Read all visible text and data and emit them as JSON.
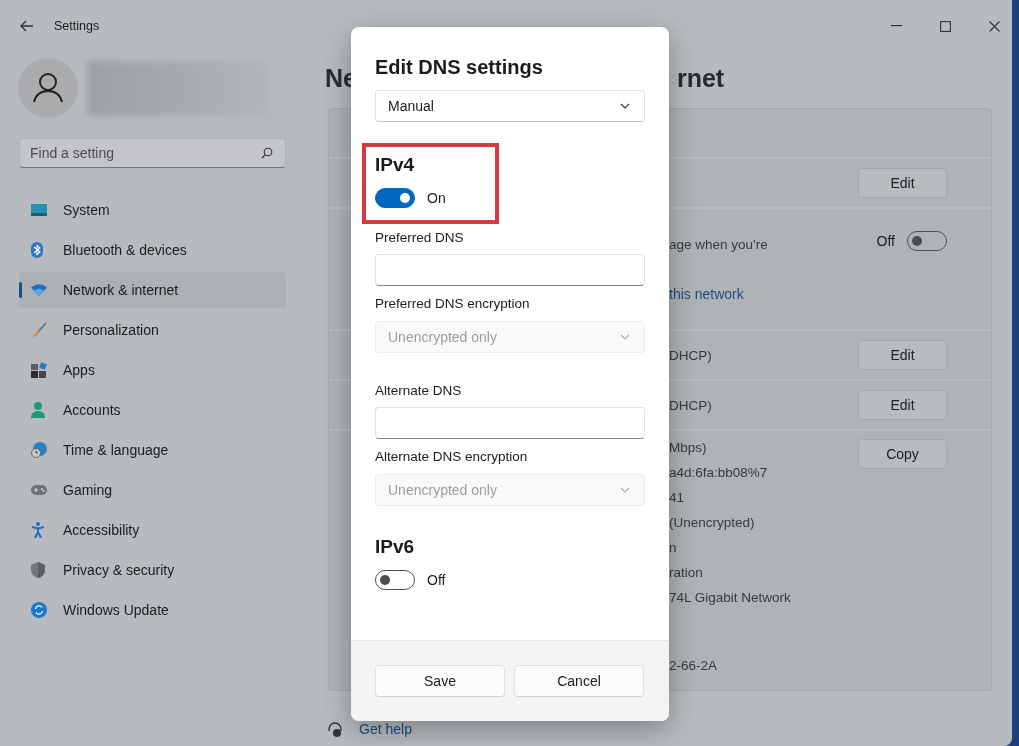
{
  "window": {
    "title": "Settings"
  },
  "sidebar": {
    "search": {
      "placeholder": "Find a setting"
    },
    "items": [
      {
        "label": "System",
        "selected": false
      },
      {
        "label": "Bluetooth & devices",
        "selected": false
      },
      {
        "label": "Network & internet",
        "selected": true
      },
      {
        "label": "Personalization",
        "selected": false
      },
      {
        "label": "Apps",
        "selected": false
      },
      {
        "label": "Accounts",
        "selected": false
      },
      {
        "label": "Time & language",
        "selected": false
      },
      {
        "label": "Gaming",
        "selected": false
      },
      {
        "label": "Accessibility",
        "selected": false
      },
      {
        "label": "Privacy & security",
        "selected": false
      },
      {
        "label": "Windows Update",
        "selected": false
      }
    ]
  },
  "page": {
    "title_parts": [
      "Ne",
      "rnet"
    ],
    "rows": [
      {
        "button": "Edit"
      },
      {
        "lines": [
          {
            "kind": "text",
            "text": "age when you're"
          },
          {
            "kind": "link",
            "text": "this network"
          }
        ],
        "toggle": {
          "on": false,
          "label": "Off"
        }
      },
      {
        "lines": [
          {
            "kind": "text",
            "text": "DHCP)"
          }
        ],
        "button": "Edit"
      },
      {
        "lines": [
          {
            "kind": "text",
            "text": "DHCP)"
          }
        ],
        "button": "Edit"
      },
      {
        "lines": [
          {
            "kind": "text",
            "text": "Mbps)"
          },
          {
            "kind": "text",
            "text": "a4d:6fa:bb08%7"
          },
          {
            "kind": "text",
            "text": "41"
          },
          {
            "kind": "text",
            "text": "(Unencrypted)"
          },
          {
            "kind": "text",
            "text": "n"
          },
          {
            "kind": "text",
            "text": "ration"
          },
          {
            "kind": "text",
            "text": "74L Gigabit Network"
          }
        ],
        "footer_line": "2-66-2A",
        "button": "Copy"
      }
    ],
    "help_link": "Get help"
  },
  "dialog": {
    "title": "Edit DNS settings",
    "mode": {
      "value": "Manual"
    },
    "sections": [
      {
        "heading": "IPv4",
        "highlighted": true,
        "toggle": {
          "on": true,
          "label": "On"
        },
        "fields": [
          {
            "kind": "input",
            "label": "Preferred DNS"
          },
          {
            "kind": "select",
            "label": "Preferred DNS encryption",
            "value": "Unencrypted only",
            "disabled": true
          },
          {
            "kind": "input",
            "label": "Alternate DNS"
          },
          {
            "kind": "select",
            "label": "Alternate DNS encryption",
            "value": "Unencrypted only",
            "disabled": true
          }
        ]
      },
      {
        "heading": "IPv6",
        "highlighted": false,
        "toggle": {
          "on": false,
          "label": "Off"
        }
      }
    ],
    "buttons": [
      "Save",
      "Cancel"
    ]
  }
}
